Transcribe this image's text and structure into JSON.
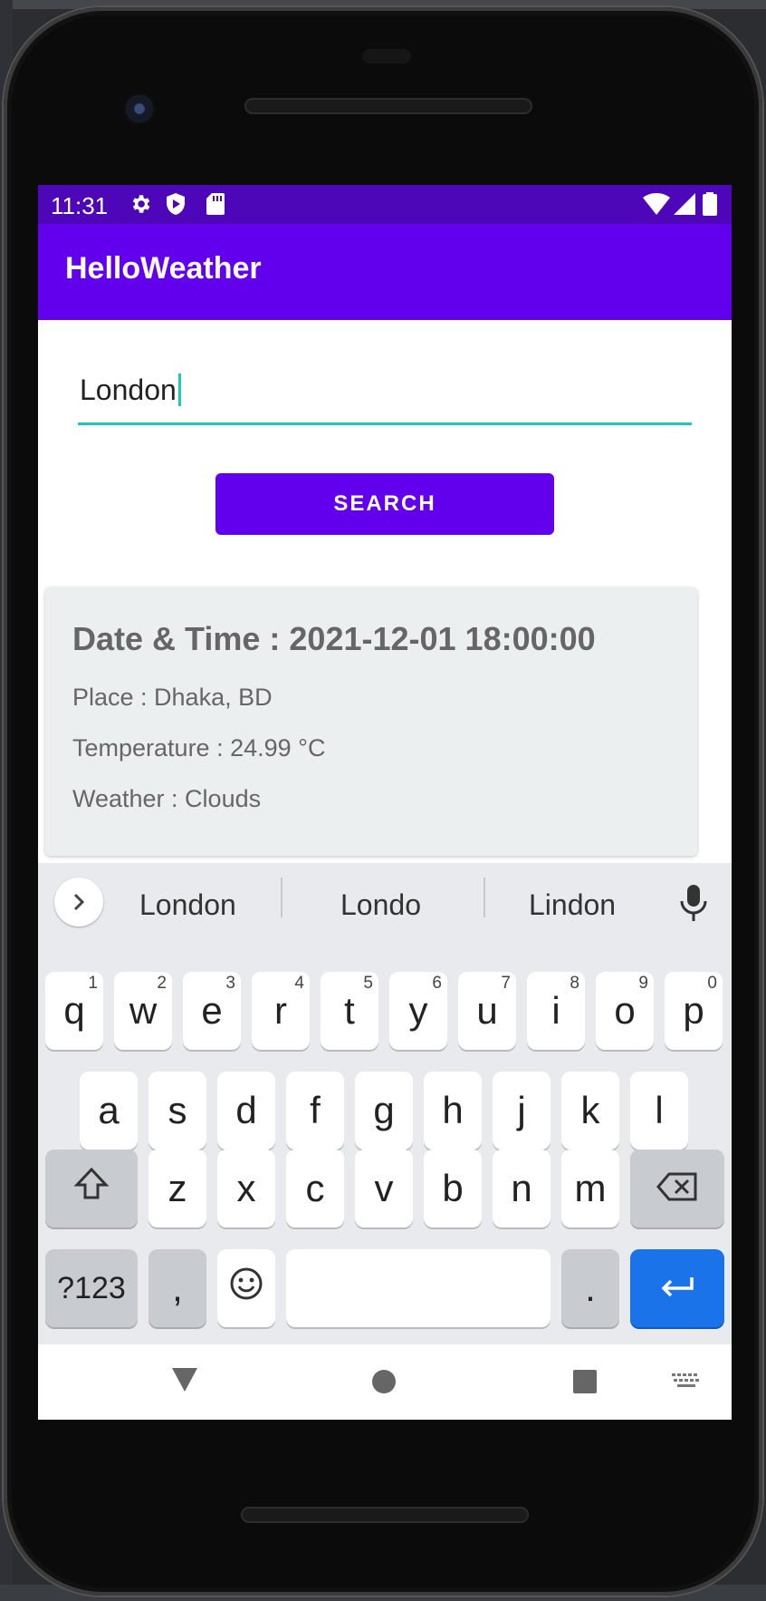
{
  "status_bar": {
    "time": "11:31"
  },
  "app_bar": {
    "title": "HelloWeather"
  },
  "search": {
    "value": "London",
    "button_label": "SEARCH"
  },
  "weather_card": {
    "datetime": "Date & Time : 2021-12-01 18:00:00",
    "place": "Place : Dhaka, BD",
    "temperature": "Temperature : 24.99 °C",
    "weather": "Weather : Clouds"
  },
  "keyboard": {
    "suggestions": [
      "London",
      "Londo",
      "Lindon"
    ],
    "row1": [
      {
        "label": "q",
        "hint": "1"
      },
      {
        "label": "w",
        "hint": "2"
      },
      {
        "label": "e",
        "hint": "3"
      },
      {
        "label": "r",
        "hint": "4"
      },
      {
        "label": "t",
        "hint": "5"
      },
      {
        "label": "y",
        "hint": "6"
      },
      {
        "label": "u",
        "hint": "7"
      },
      {
        "label": "i",
        "hint": "8"
      },
      {
        "label": "o",
        "hint": "9"
      },
      {
        "label": "p",
        "hint": "0"
      }
    ],
    "row2": [
      "a",
      "s",
      "d",
      "f",
      "g",
      "h",
      "j",
      "k",
      "l"
    ],
    "row3": [
      "z",
      "x",
      "c",
      "v",
      "b",
      "n",
      "m"
    ],
    "symbols_label": "?123",
    "comma_label": ",",
    "period_label": "."
  },
  "colors": {
    "primary": "#6200ee",
    "primary_dark": "#4d06b8",
    "accent": "#1fc8b8",
    "enter_key": "#1a73e8"
  },
  "icons": [
    "settings-icon",
    "shield-icon",
    "sd-card-icon",
    "wifi-icon",
    "signal-icon",
    "battery-icon",
    "chevron-right-icon",
    "mic-icon",
    "shift-icon",
    "backspace-icon",
    "emoji-icon",
    "enter-icon",
    "back-icon",
    "home-icon",
    "recents-icon",
    "keyboard-icon"
  ]
}
